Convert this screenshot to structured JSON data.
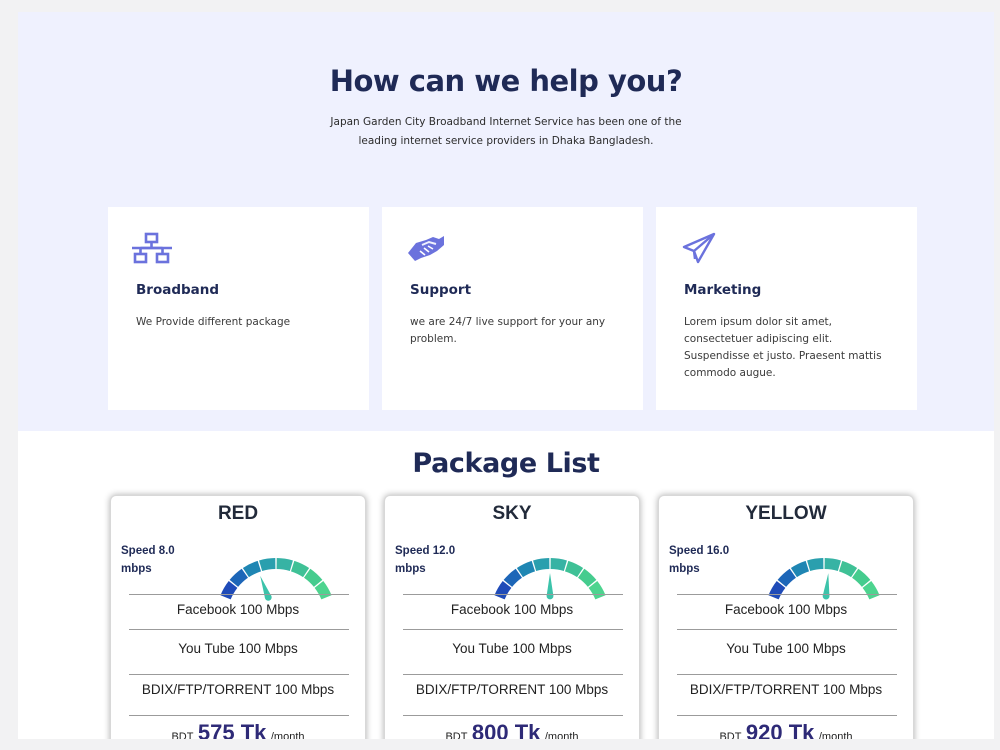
{
  "hero": {
    "title": "How can we help you?",
    "subtitle": "Japan Garden City Broadband Internet Service has been one of the leading internet service providers in Dhaka Bangladesh."
  },
  "services": [
    {
      "icon": "network-icon",
      "title": "Broadband",
      "desc": "We Provide different package"
    },
    {
      "icon": "handshake-icon",
      "title": "Support",
      "desc": "we are 24/7 live support for your any problem."
    },
    {
      "icon": "paper-plane-icon",
      "title": "Marketing",
      "desc": "Lorem ipsum dolor sit amet, consectetuer adipiscing elit. Suspendisse et justo. Praesent mattis commodo augue."
    }
  ],
  "packages": {
    "title": "Package List",
    "items": [
      {
        "name": "RED",
        "speed": "Speed 8.0",
        "unit": "mbps",
        "gauge_level": 0.35,
        "features": [
          "Facebook 100 Mbps",
          "You Tube 100 Mbps",
          "BDIX/FTP/TORRENT 100 Mbps"
        ],
        "currency": "BDT",
        "amount": "575 Tk",
        "per": "/month"
      },
      {
        "name": "SKY",
        "speed": "Speed 12.0",
        "unit": "mbps",
        "gauge_level": 0.5,
        "features": [
          "Facebook 100 Mbps",
          "You Tube 100 Mbps",
          "BDIX/FTP/TORRENT 100 Mbps"
        ],
        "currency": "BDT",
        "amount": "800 Tk",
        "per": "/month"
      },
      {
        "name": "YELLOW",
        "speed": "Speed 16.0",
        "unit": "mbps",
        "gauge_level": 0.54,
        "features": [
          "Facebook 100 Mbps",
          "You Tube 100 Mbps",
          "BDIX/FTP/TORRENT 100 Mbps"
        ],
        "currency": "BDT",
        "amount": "920 Tk",
        "per": "/month"
      }
    ]
  },
  "colors": {
    "hero_bg": "#eff1fe",
    "heading": "#1f2a56",
    "icon": "#6b72dd",
    "gauge": [
      "#1f4bb8",
      "#1d66b8",
      "#1f86b3",
      "#2a9fae",
      "#37b3a4",
      "#3fc196",
      "#45cc8e",
      "#4dd48f"
    ],
    "needle": "#3cc3aa"
  }
}
